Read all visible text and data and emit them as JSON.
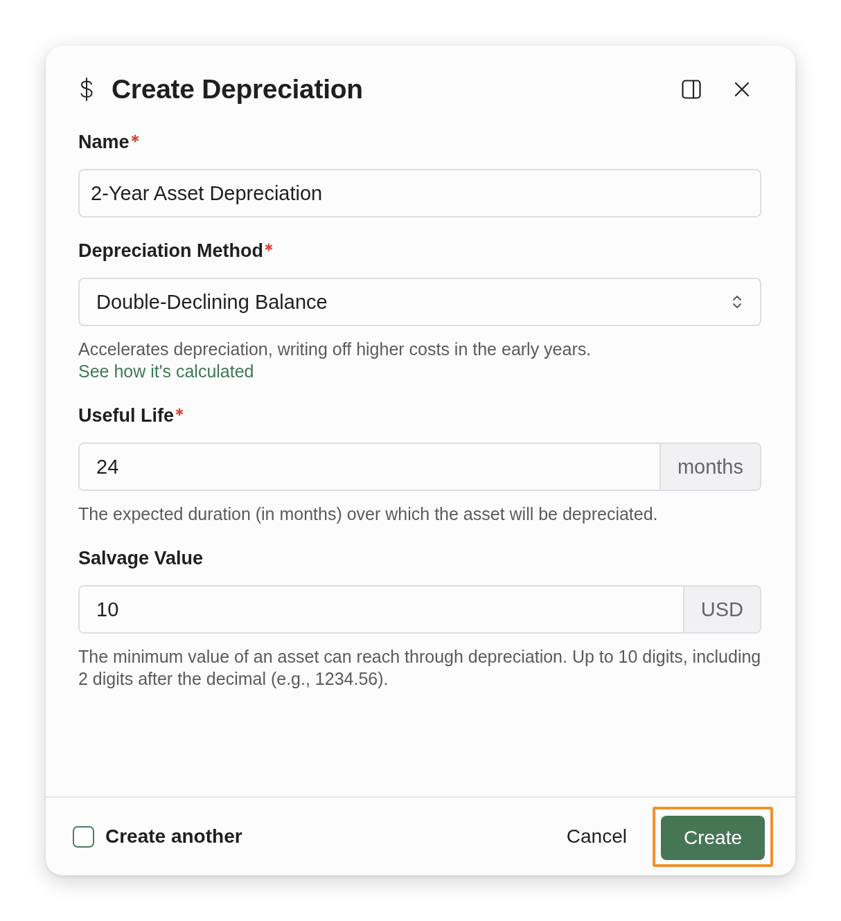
{
  "dialog": {
    "title": "Create Depreciation"
  },
  "fields": [
    {
      "kind": "text",
      "label": "Name",
      "required": true,
      "value": "2-Year Asset Depreciation"
    },
    {
      "kind": "select",
      "label": "Depreciation Method",
      "required": true,
      "value": "Double-Declining Balance",
      "helper": {
        "text": "Accelerates depreciation, writing off higher costs in the early years.",
        "link": "See how it's calculated"
      }
    },
    {
      "kind": "addon",
      "label": "Useful Life",
      "required": true,
      "value": "24",
      "suffix": "months",
      "helper": {
        "text": "The expected duration (in months) over which the asset will be depreciated."
      }
    },
    {
      "kind": "addon",
      "label": "Salvage Value",
      "required": false,
      "value": "10",
      "suffix": "USD",
      "helper": {
        "text": "The minimum value of an asset can reach through depreciation. Up to 10 digits, including 2 digits after the decimal (e.g., 1234.56)."
      }
    }
  ],
  "footer": {
    "create_another": {
      "label": "Create another",
      "checked": false
    },
    "buttons": [
      {
        "kind": "text",
        "label": "Cancel",
        "highlighted": false
      },
      {
        "kind": "primary",
        "label": "Create",
        "highlighted": true
      }
    ]
  }
}
